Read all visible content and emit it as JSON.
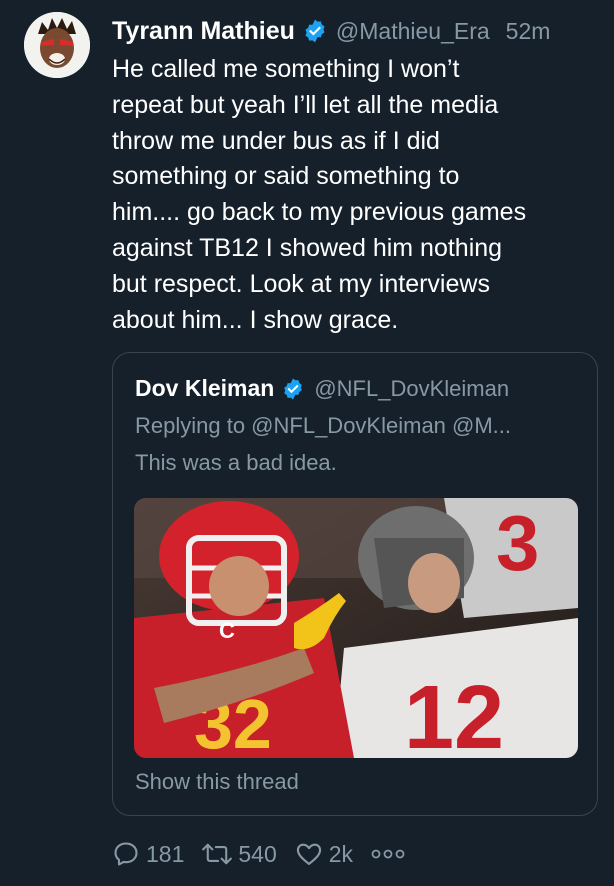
{
  "tweet": {
    "author_name": "Tyrann Mathieu",
    "handle": "@Mathieu_Era",
    "time": "52m",
    "text": "He called me something I won’t\nrepeat but yeah I’ll let all the media\nthrow me under bus as if I did\nsomething or said something to\nhim.... go back to my previous games\nagainst TB12 I showed him nothing\nbut respect. Look at my interviews\nabout him... I show grace."
  },
  "quote": {
    "author_name": "Dov Kleiman",
    "handle": "@NFL_DovKleiman",
    "replying_to": "Replying to @NFL_DovKleiman @M...",
    "text": "This was a bad idea.",
    "show_thread": "Show this thread"
  },
  "actions": {
    "replies": "181",
    "retweets": "540",
    "likes": "2k"
  },
  "colors": {
    "background": "#15202b",
    "secondary_text": "#8899a6",
    "verified": "#1da1f2",
    "border": "#38444d"
  },
  "icons": [
    "verified-badge-icon",
    "reply-icon",
    "retweet-icon",
    "like-icon",
    "more-icon"
  ]
}
